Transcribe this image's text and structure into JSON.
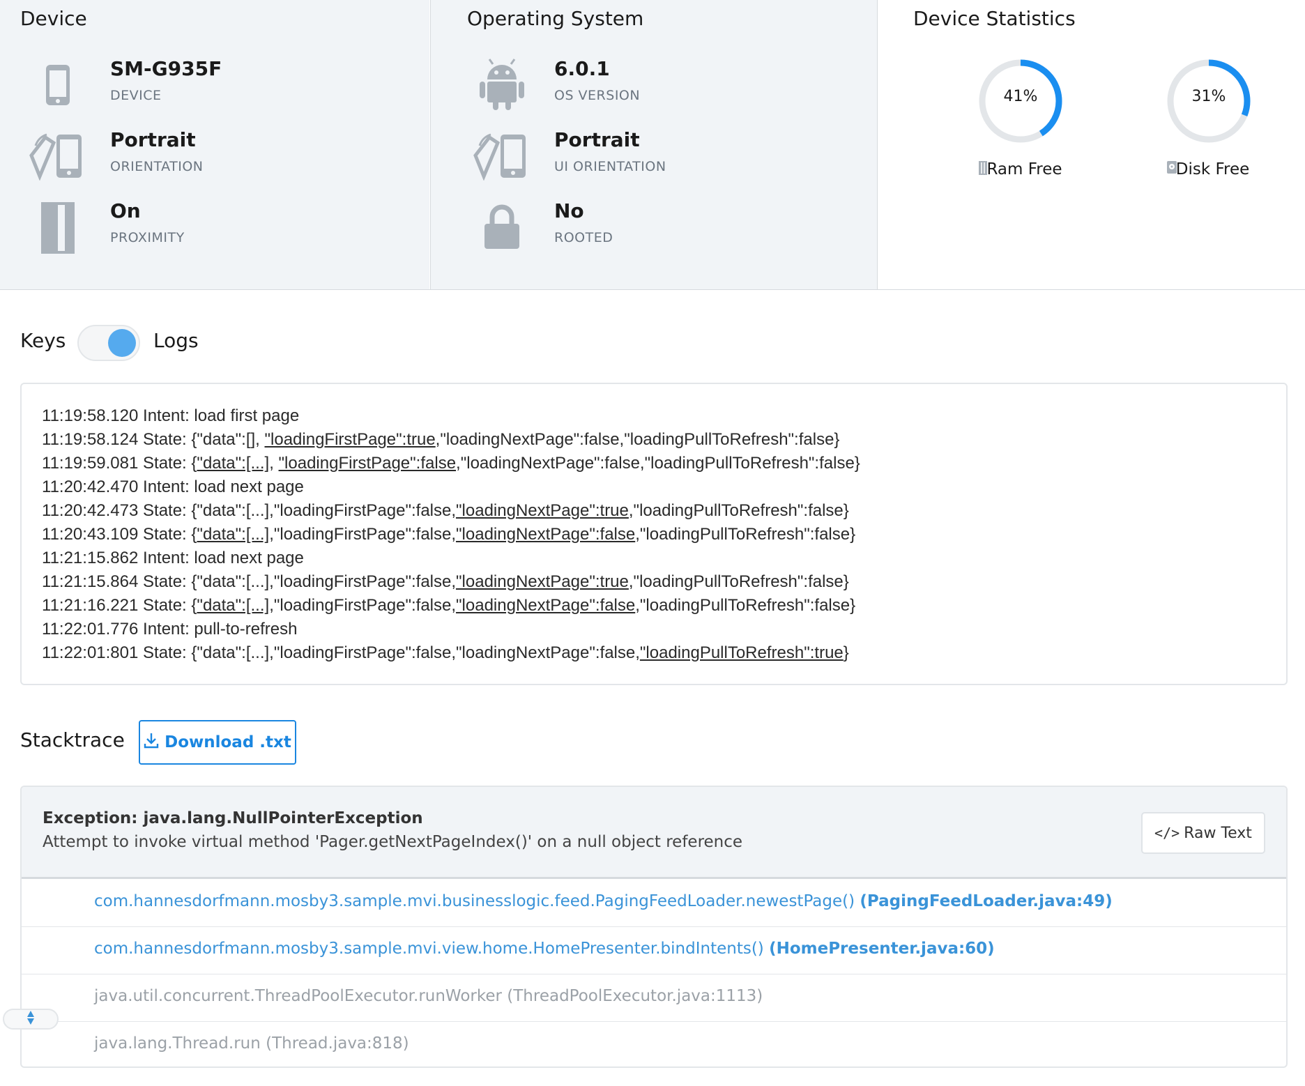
{
  "device_panel": {
    "title": "Device",
    "items": [
      {
        "value": "SM-G935F",
        "label": "DEVICE",
        "icon": "phone-icon"
      },
      {
        "value": "Portrait",
        "label": "ORIENTATION",
        "icon": "rotate-device-icon"
      },
      {
        "value": "On",
        "label": "PROXIMITY",
        "icon": "proximity-icon"
      }
    ]
  },
  "os_panel": {
    "title": "Operating System",
    "items": [
      {
        "value": "6.0.1",
        "label": "OS VERSION",
        "icon": "android-icon"
      },
      {
        "value": "Portrait",
        "label": "UI ORIENTATION",
        "icon": "rotate-device-icon"
      },
      {
        "value": "No",
        "label": "ROOTED",
        "icon": "lock-icon"
      }
    ]
  },
  "stats_panel": {
    "title": "Device Statistics",
    "ram": {
      "percent_text": "41%",
      "fraction": 0.41,
      "label": "Ram Free",
      "icon": "memory-icon"
    },
    "disk": {
      "percent_text": "31%",
      "fraction": 0.31,
      "label": "Disk Free",
      "icon": "disk-icon"
    }
  },
  "toggle": {
    "left_label": "Keys",
    "right_label": "Logs",
    "selected": "Logs"
  },
  "logs": [
    [
      {
        "t": "11:19:58.120 Intent: load first page"
      }
    ],
    [
      {
        "t": "11:19:58.124 State: {\"data\":[], "
      },
      {
        "t": "\"loadingFirstPage\":true",
        "u": true
      },
      {
        "t": ",\"loadingNextPage\":false,\"loadingPullToRefresh\":false}"
      }
    ],
    [
      {
        "t": "11:19:59.081 State: {"
      },
      {
        "t": "\"data\":[...]",
        "u": true
      },
      {
        "t": ", "
      },
      {
        "t": "\"loadingFirstPage\":false",
        "u": true
      },
      {
        "t": ",\"loadingNextPage\":false,\"loadingPullToRefresh\":false}"
      }
    ],
    [
      {
        "t": "11:20:42.470 Intent: load next page"
      }
    ],
    [
      {
        "t": "11:20:42.473 State: {\"data\":[...],\"loadingFirstPage\":false,"
      },
      {
        "t": "\"loadingNextPage\":true",
        "u": true
      },
      {
        "t": ",\"loadingPullToRefresh\":false}"
      }
    ],
    [
      {
        "t": "11:20:43.109 State: {"
      },
      {
        "t": "\"data\":[...]",
        "u": true
      },
      {
        "t": ",\"loadingFirstPage\":false,"
      },
      {
        "t": "\"loadingNextPage\":false",
        "u": true
      },
      {
        "t": ",\"loadingPullToRefresh\":false}"
      }
    ],
    [
      {
        "t": "11:21:15.862 Intent: load next page"
      }
    ],
    [
      {
        "t": "11:21:15.864 State: {\"data\":[...],\"loadingFirstPage\":false,"
      },
      {
        "t": "\"loadingNextPage\":true",
        "u": true
      },
      {
        "t": ",\"loadingPullToRefresh\":false}"
      }
    ],
    [
      {
        "t": "11:21:16.221 State: {"
      },
      {
        "t": "\"data\":[...]",
        "u": true
      },
      {
        "t": ",\"loadingFirstPage\":false,"
      },
      {
        "t": "\"loadingNextPage\":false",
        "u": true
      },
      {
        "t": ",\"loadingPullToRefresh\":false}"
      }
    ],
    [
      {
        "t": "11:22:01.776 Intent: pull-to-refresh"
      }
    ],
    [
      {
        "t": "11:22:01:801 State: {\"data\":[...],\"loadingFirstPage\":false,\"loadingNextPage\":false,"
      },
      {
        "t": "\"loadingPullToRefresh\":true",
        "u": true
      },
      {
        "t": "}"
      }
    ]
  ],
  "stacktrace": {
    "title": "Stacktrace",
    "download_label": "Download .txt",
    "exception_title": "Exception: java.lang.NullPointerException",
    "exception_message": "Attempt to invoke virtual method 'Pager.getNextPageIndex()' on a null object reference",
    "raw_label": "Raw Text",
    "frames": [
      {
        "method": "com.hannesdorfmann.mosby3.sample.mvi.businesslogic.feed.PagingFeedLoader.newestPage() ",
        "location": "(PagingFeedLoader.java:49)",
        "app": true
      },
      {
        "method": "com.hannesdorfmann.mosby3.sample.mvi.view.home.HomePresenter.bindIntents() ",
        "location": "(HomePresenter.java:60)",
        "app": true
      },
      {
        "method": "java.util.concurrent.ThreadPoolExecutor.runWorker (ThreadPoolExecutor.java:1113)",
        "location": "",
        "app": false
      },
      {
        "method": "java.lang.Thread.run (Thread.java:818)",
        "location": "",
        "app": false
      }
    ]
  },
  "colors": {
    "accent": "#1a86e0",
    "ring": "#1a8ef0",
    "ring_track": "#e3e6e9",
    "panel_bg": "#f1f4f7",
    "icon_gray": "#a9b1b9"
  }
}
